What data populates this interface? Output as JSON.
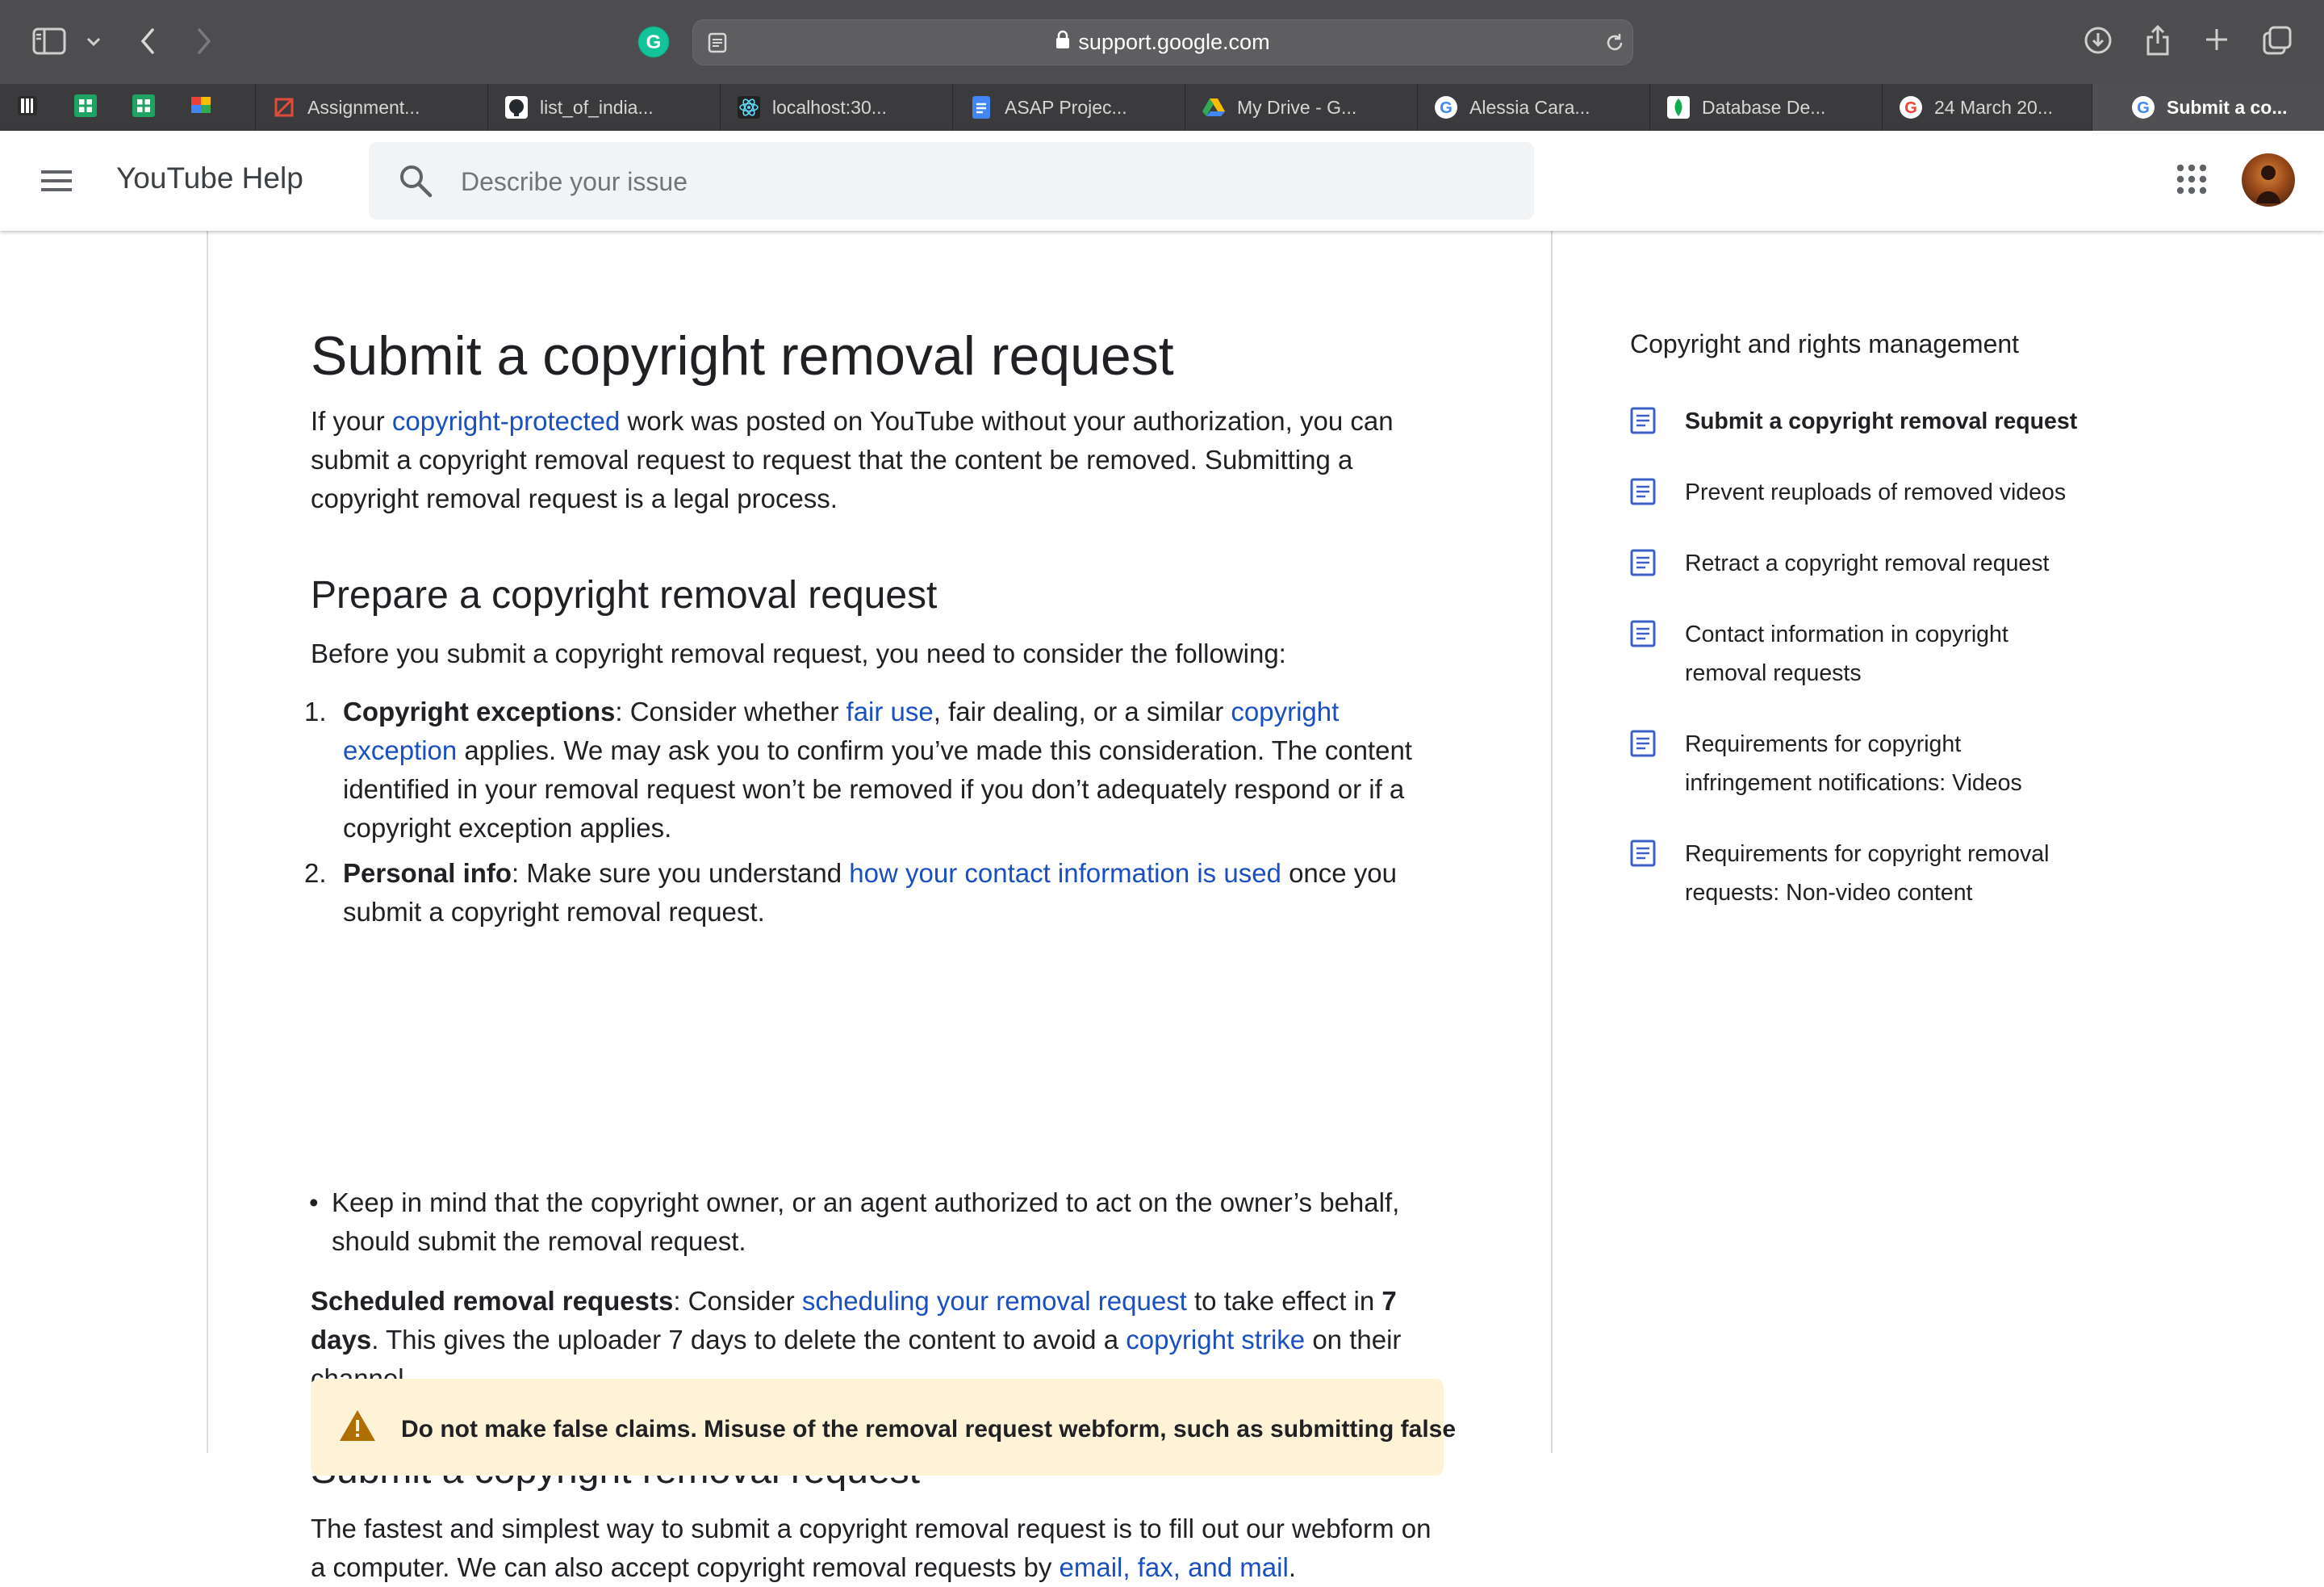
{
  "browser": {
    "url": "support.google.com",
    "tabs": [
      {
        "label": "Assignment..."
      },
      {
        "label": "list_of_india..."
      },
      {
        "label": "localhost:30..."
      },
      {
        "label": "ASAP Projec..."
      },
      {
        "label": "My Drive - G..."
      },
      {
        "label": "Alessia Cara..."
      },
      {
        "label": "Database De..."
      },
      {
        "label": "24 March 20..."
      },
      {
        "label": "Submit a co..."
      }
    ]
  },
  "header": {
    "brand": "YouTube Help",
    "search_placeholder": "Describe your issue"
  },
  "article": {
    "title": "Submit a copyright removal request",
    "intro": {
      "pre": "If your ",
      "link": "copyright-protected",
      "post": " work was posted on YouTube without your authorization, you can submit a copyright removal request to request that the content be removed. Submitting a copyright removal request is a legal process."
    },
    "section1": {
      "heading": "Prepare a copyright removal request",
      "lead": "Before you submit a copyright removal request, you need to consider the following:",
      "item1": {
        "num": "1.",
        "bold": "Copyright exceptions",
        "t1": ": Consider whether ",
        "link1": "fair use",
        "t2": ", fair dealing, or a similar ",
        "link2": "copyright exception",
        "t3": " applies. We may ask you to confirm you’ve made this consideration. The content identified in your removal request won’t be removed if you don’t adequately respond or if a copyright exception applies."
      },
      "item2": {
        "num": "2.",
        "bold": "Personal info",
        "t1": ": Make sure you understand ",
        "link1": "how your contact information is used",
        "t2": " once you submit a copyright removal request."
      },
      "bullet": "Keep in mind that the copyright owner, or an agent authorized to act on the owner’s behalf, should submit the removal request.",
      "scheduled": {
        "bold": "Scheduled removal requests",
        "t1": ": Consider ",
        "link1": "scheduling your removal request",
        "t2": " to take effect in ",
        "bold2": "7 days",
        "t3": ". This gives the uploader 7 days to delete the content to avoid a ",
        "link2": "copyright strike",
        "t4": " on their channel."
      }
    },
    "section2": {
      "heading": "Submit a copyright removal request",
      "p1": "The fastest and simplest way to submit a copyright removal request is to fill out our webform on a computer. We can also accept copyright removal requests by ",
      "link": "email, fax, and mail",
      "p2": "."
    },
    "warning": "Do not make false claims. Misuse of the removal request webform, such as submitting false"
  },
  "sidebar": {
    "title": "Copyright and rights management",
    "items": [
      {
        "label": "Submit a copyright removal request"
      },
      {
        "label": "Prevent reuploads of removed videos"
      },
      {
        "label": "Retract a copyright removal request"
      },
      {
        "label": "Contact information in copyright removal requests"
      },
      {
        "label": "Requirements for copyright infringement notifications: Videos"
      },
      {
        "label": "Requirements for copyright removal requests: Non-video content"
      }
    ]
  },
  "colors": {
    "link": "#1a4fbf",
    "doc_icon": "#3c5fc8",
    "warning_bg": "#fef3d7",
    "warning_icon": "#b06d00"
  },
  "icons": [
    "sidebar-toggle-icon",
    "back-icon",
    "forward-icon",
    "grammarly-icon",
    "reader-icon",
    "lock-icon",
    "reload-icon",
    "download-icon",
    "share-icon",
    "new-tab-icon",
    "tab-overview-icon",
    "menu-icon",
    "search-icon",
    "apps-grid-icon",
    "document-icon",
    "warning-icon"
  ]
}
